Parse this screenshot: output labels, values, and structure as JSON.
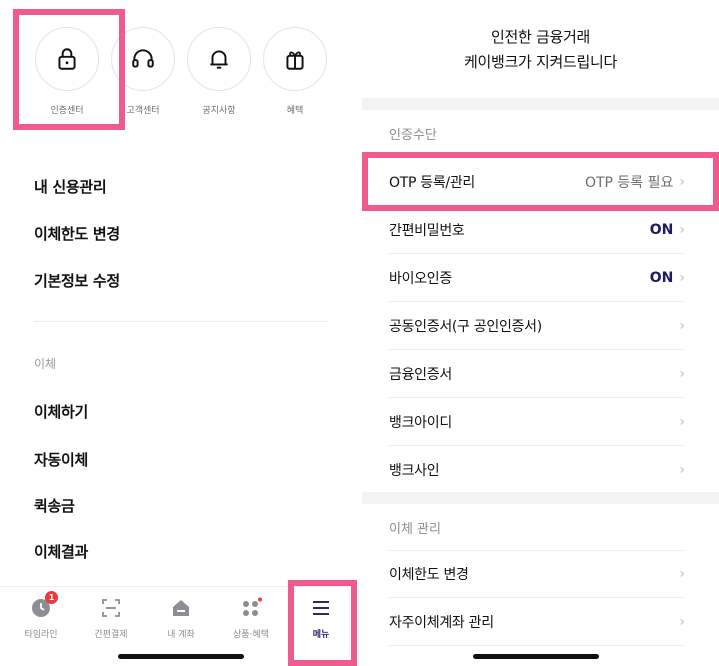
{
  "left_screen": {
    "quick_actions": [
      {
        "label": "인증센터",
        "icon": "lock-icon"
      },
      {
        "label": "고객센터",
        "icon": "headset-icon"
      },
      {
        "label": "공지사항",
        "icon": "bell-icon"
      },
      {
        "label": "혜택",
        "icon": "gift-icon"
      }
    ],
    "menu_items": [
      "내 신용관리",
      "이체한도 변경",
      "기본정보 수정"
    ],
    "transfer_section": {
      "title": "이체",
      "items": [
        "이체하기",
        "자동이체",
        "퀵송금",
        "이체결과"
      ]
    },
    "tab_bar": {
      "tabs": [
        {
          "label": "타임라인",
          "icon": "clock-icon",
          "badge": "1"
        },
        {
          "label": "간편결제",
          "icon": "scan-icon"
        },
        {
          "label": "내 계좌",
          "icon": "home-icon"
        },
        {
          "label": "상품·혜택",
          "icon": "grid-dots-icon"
        },
        {
          "label": "메뉴",
          "icon": "menu-icon",
          "active": true
        }
      ]
    }
  },
  "right_screen": {
    "header": {
      "line1": "인전한 금융거래",
      "line2": "케이뱅크가 지켜드립니다"
    },
    "auth_section": {
      "title": "인증수단",
      "rows": [
        {
          "label": "OTP 등록/관리",
          "status": "OTP 등록 필요"
        },
        {
          "label": "간편비밀번호",
          "status": "ON"
        },
        {
          "label": "바이오인증",
          "status": "ON"
        },
        {
          "label": "공동인증서(구 공인인증서)"
        },
        {
          "label": "금융인증서"
        },
        {
          "label": "뱅크아이디"
        },
        {
          "label": "뱅크사인"
        }
      ]
    },
    "transfer_mgmt_section": {
      "title": "이체 관리",
      "rows": [
        {
          "label": "이체한도 변경"
        },
        {
          "label": "자주이체계좌 관리"
        }
      ]
    }
  },
  "colors": {
    "highlight": "#ef5a8f",
    "accent": "#1e1a6b",
    "badge": "#e93b3b",
    "divider": "#ededf0",
    "section_band": "#f3f3f5"
  },
  "chevron": "›"
}
